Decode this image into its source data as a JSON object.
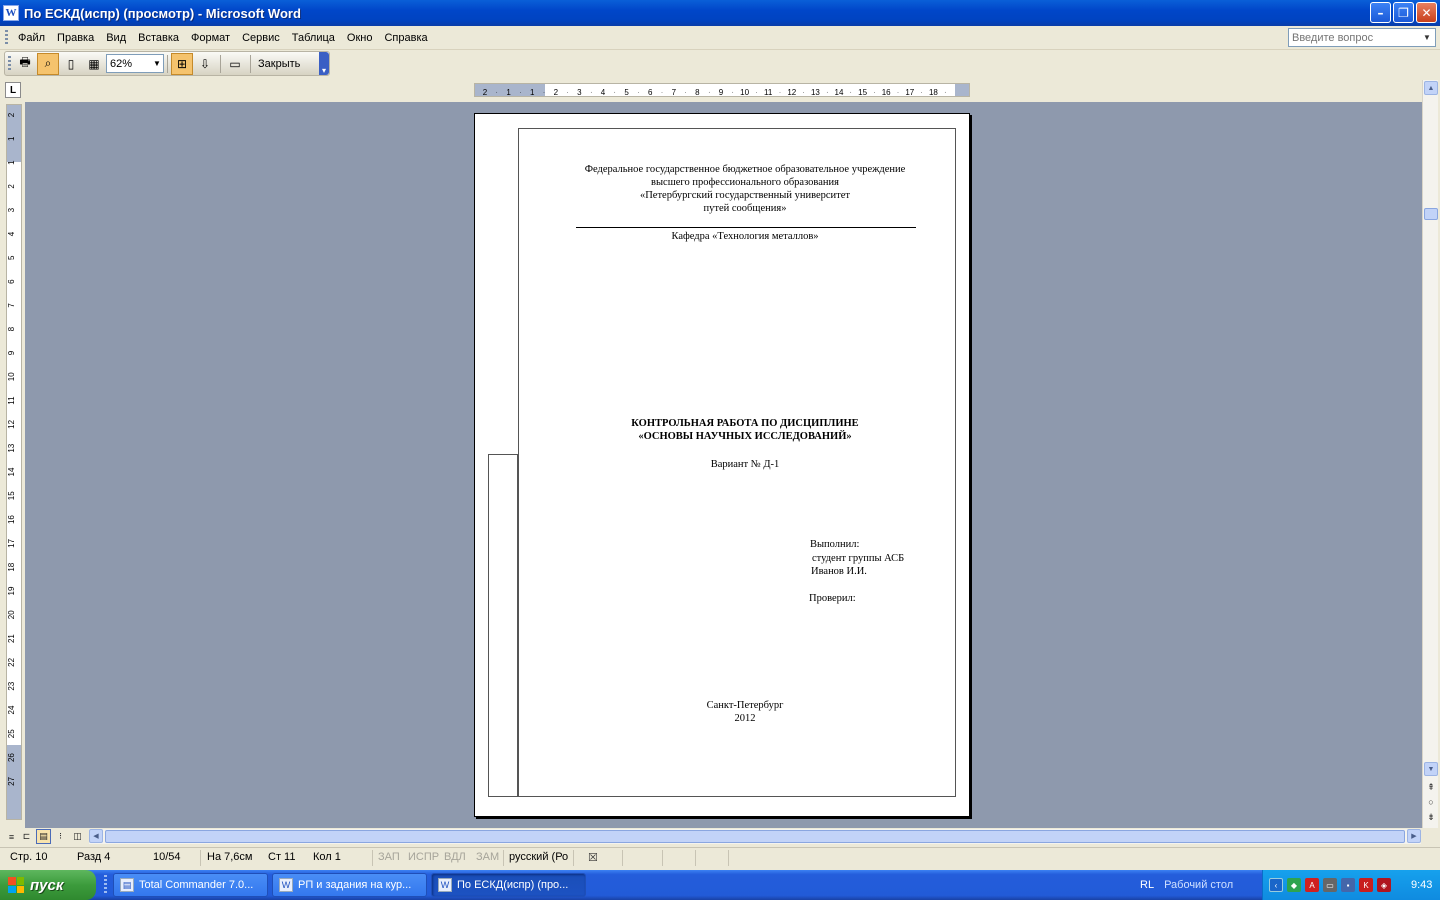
{
  "window": {
    "title": "По ЕСКД(испр) (просмотр) - Microsoft Word",
    "app_icon": "word-icon"
  },
  "menu": {
    "items": [
      "Файл",
      "Правка",
      "Вид",
      "Вставка",
      "Формат",
      "Сервис",
      "Таблица",
      "Окно",
      "Справка"
    ],
    "help_placeholder": "Введите вопрос"
  },
  "toolbar": {
    "zoom": "62%",
    "close_label": "Закрыть"
  },
  "ruler": {
    "horizontal_labels": [
      "2",
      "1",
      "1",
      "2",
      "3",
      "4",
      "5",
      "6",
      "7",
      "8",
      "9",
      "10",
      "11",
      "12",
      "13",
      "14",
      "15",
      "16",
      "17",
      "18"
    ],
    "vertical_labels": [
      "2",
      "1",
      "1",
      "2",
      "3",
      "4",
      "5",
      "6",
      "7",
      "8",
      "9",
      "10",
      "11",
      "12",
      "13",
      "14",
      "15",
      "16",
      "17",
      "18",
      "19",
      "20",
      "21",
      "22",
      "23",
      "24",
      "25",
      "26",
      "27"
    ]
  },
  "document": {
    "header_lines": [
      "Федеральное государственное бюджетное образовательное учреждение",
      "высшего профессионального образования",
      "«Петербургский государственный университет",
      "путей сообщения»"
    ],
    "department": "Кафедра «Технология металлов»",
    "title_line1": "КОНТРОЛЬНАЯ РАБОТА ПО ДИСЦИПЛИНЕ",
    "title_line2": "«ОСНОВЫ НАУЧНЫХ ИССЛЕДОВАНИЙ»",
    "variant": "Вариант № Д-1",
    "performed_label": "Выполнил:",
    "student_group": "студент группы АСБ",
    "student_name": "Иванов И.И.",
    "checked_label": "Проверил:",
    "city": "Санкт-Петербург",
    "year": "2012"
  },
  "statusbar": {
    "page": "Стр. 10",
    "section": "Разд  4",
    "page_of": "10/54",
    "at": "На 7,6см",
    "line": "Ст  11",
    "col": "Кол  1",
    "rec": "ЗАП",
    "trk": "ИСПР",
    "ext": "ВДЛ",
    "ovr": "ЗАМ",
    "lang": "русский (Ро"
  },
  "taskbar": {
    "start_label": "пуск",
    "tasks": [
      {
        "label": "Total Commander 7.0...",
        "active": false
      },
      {
        "label": "РП и задания на кур...",
        "active": false
      },
      {
        "label": "По ЕСКД(испр) (про...",
        "active": true
      }
    ],
    "lang": "RL",
    "desktop_label": "Рабочий стол",
    "clock": "9:43"
  }
}
